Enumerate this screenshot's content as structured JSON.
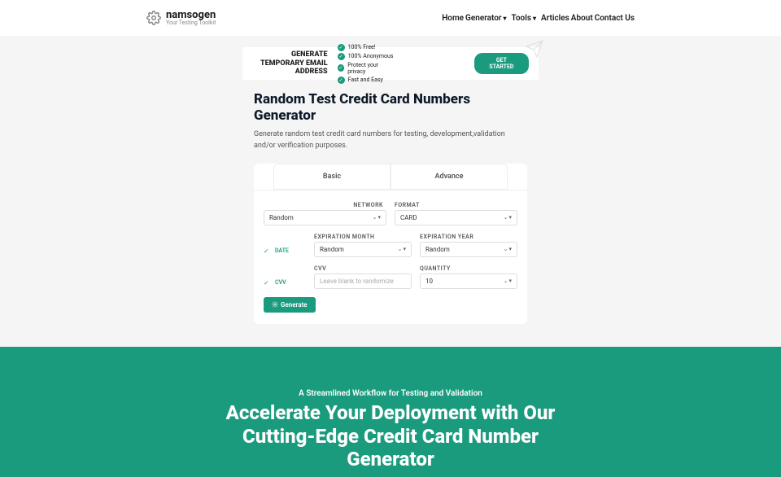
{
  "logo": {
    "name": "namsogen",
    "tagline": "Your Testing Toolkit"
  },
  "nav": [
    "Home",
    "Generator",
    "Tools",
    "Articles",
    "About",
    "Contact Us"
  ],
  "banner": {
    "title": "GENERATE TEMPORARY EMAIL ADDRESS",
    "features": [
      "100% Free!",
      "100% Anonymous",
      "Protect your privacy",
      "Fast and Easy"
    ],
    "cta": "GET STARTED"
  },
  "page": {
    "title": "Random Test Credit Card Numbers Generator",
    "desc": "Generate random test credit card numbers for testing, development,validation and/or verification purposes."
  },
  "tabs": [
    "Basic",
    "Advance"
  ],
  "form": {
    "network": {
      "label": "NETWORK",
      "value": "Random"
    },
    "format": {
      "label": "FORMAT",
      "value": "CARD"
    },
    "date_toggle": "DATE",
    "exp_month": {
      "label": "EXPIRATION MONTH",
      "value": "Random"
    },
    "exp_year": {
      "label": "EXPIRATION YEAR",
      "value": "Random"
    },
    "cvv_toggle": "CVV",
    "cvv": {
      "label": "CVV",
      "placeholder": "Leave blank to randomize"
    },
    "quantity": {
      "label": "QUANTITY",
      "value": "10"
    },
    "generate": "Generate"
  },
  "footer": {
    "sub": "A Streamlined Workflow for Testing and Validation",
    "title": "Accelerate Your Deployment with Our Cutting-Edge Credit Card Number Generator"
  }
}
